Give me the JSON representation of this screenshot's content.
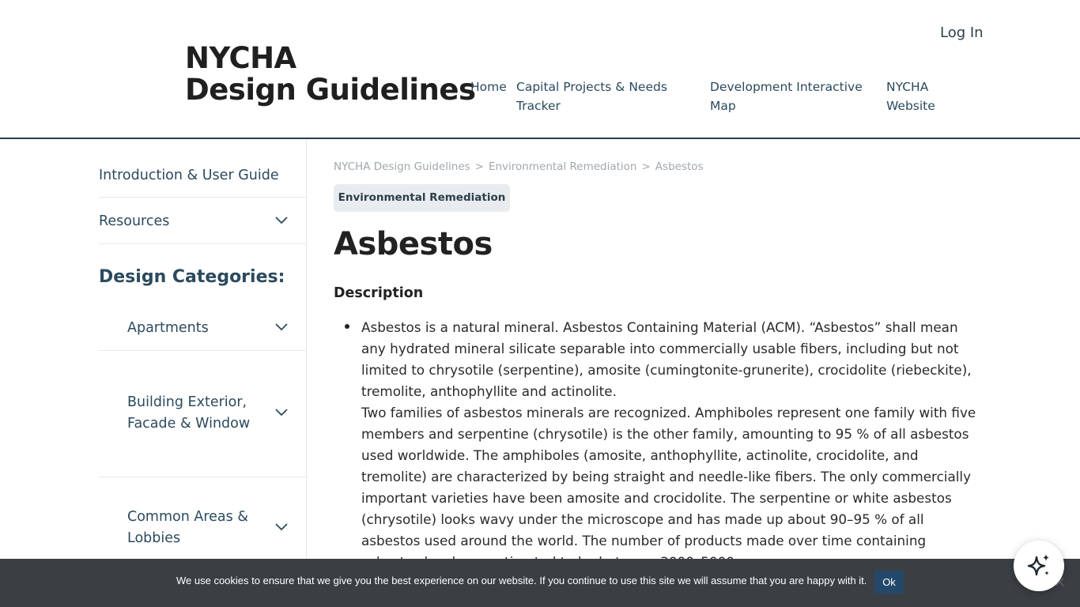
{
  "header": {
    "title_line1": "NYCHA",
    "title_line2": "Design Guidelines",
    "login_label": "Log In",
    "nav": [
      {
        "line1": "Home",
        "line2": ""
      },
      {
        "line1": "Capital Projects & Needs",
        "line2": "Tracker"
      },
      {
        "line1": "Development Interactive",
        "line2": "Map"
      },
      {
        "line1": "NYCHA",
        "line2": "Website"
      }
    ]
  },
  "sidebar": {
    "items": [
      {
        "label": "Introduction & User Guide"
      },
      {
        "label": "Resources"
      }
    ],
    "heading": "Design Categories:",
    "categories": [
      {
        "line1": "Apartments",
        "line2": ""
      },
      {
        "line1": "Building Exterior,",
        "line2": "Facade & Window"
      },
      {
        "line1": "Common Areas &",
        "line2": "Lobbies"
      }
    ]
  },
  "breadcrumb": {
    "items": [
      "NYCHA Design Guidelines",
      "Environmental Remediation",
      "Asbestos"
    ],
    "separator": ">"
  },
  "category_badge": "Environmental Remediation",
  "page_title": "Asbestos",
  "section_title": "Description",
  "content": {
    "paragraph1": "Asbestos is a natural mineral. Asbestos Containing Material (ACM). “Asbestos” shall mean any hydrated mineral silicate separable into commercially usable fibers, including but not limited to chrysotile (serpentine), amosite (cumingtonite-grunerite), crocidolite (riebeckite), tremolite, anthophyllite and actinolite.",
    "paragraph2": "Two families of asbestos minerals are recognized. Amphiboles represent one family with five members and serpentine (chrysotile) is the other family, amounting to 95 % of all asbestos used worldwide. The amphiboles (amosite, anthophyllite, actinolite, crocidolite, and tremolite) are characterized by being straight and needle-like fibers. The only commercially important varieties have been amosite and crocidolite. The serpentine or white asbestos (chrysotile) looks wavy under the microscope and has made up about 90–95 % of all asbestos used around the world. The number of products made over time containing asbestos has been estimated to be between 3000–5000."
  },
  "cookie": {
    "text": "We use cookies to ensure that we give you the best experience on our website. If you continue to use this site we will assume that you are happy with it.",
    "ok_label": "Ok",
    "close_glyph": "✕"
  },
  "icons": {
    "chevron": "chevron-down-icon",
    "ai": "sparkles-icon"
  },
  "colors": {
    "primary": "#2b4a5e",
    "header_border": "#2b3e4c",
    "cookie_bg": "#3a3f44",
    "cookie_button": "#24486a",
    "badge_bg": "#e9ecef"
  }
}
